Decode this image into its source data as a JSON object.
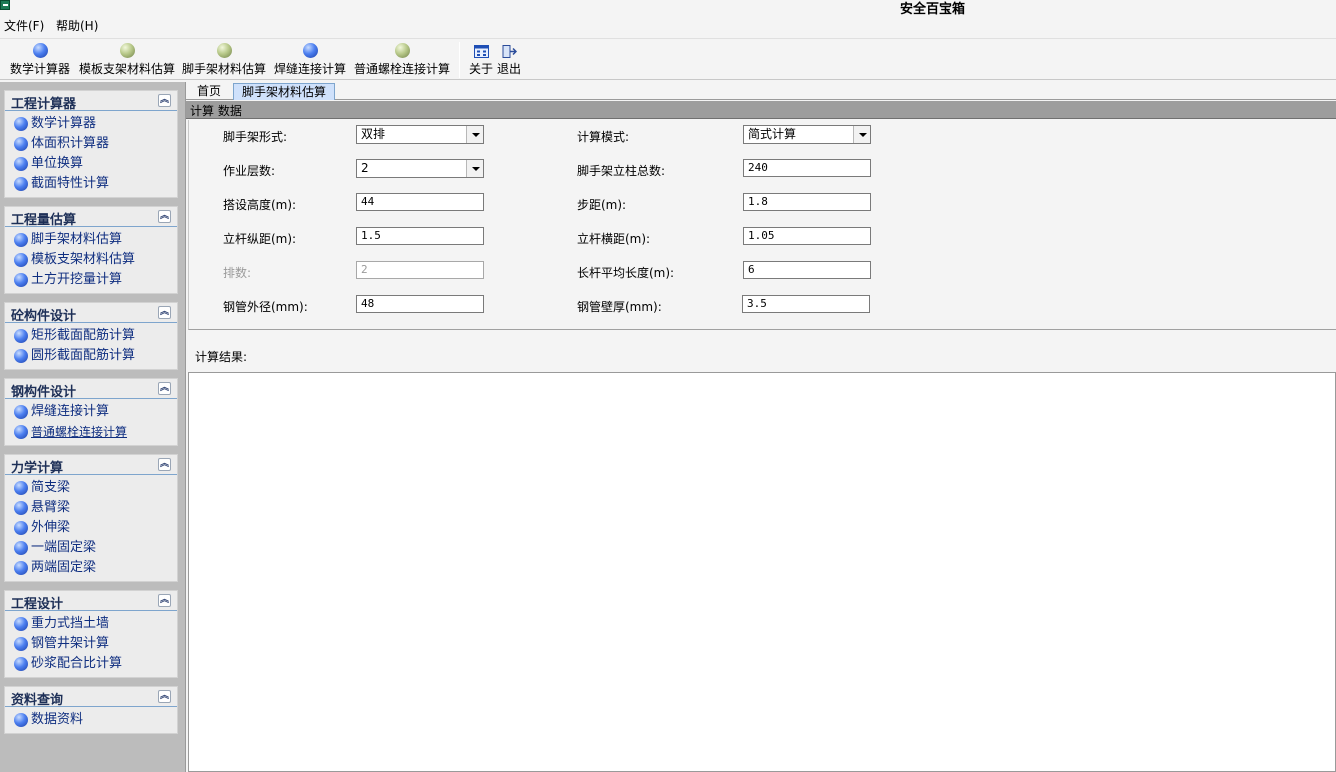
{
  "app": {
    "title": "安全百宝箱"
  },
  "menu": {
    "file": "文件(F)",
    "help": "帮助(H)"
  },
  "toolbar": {
    "buttons": [
      {
        "label": "数学计算器",
        "icon": "blue-ball-icon"
      },
      {
        "label": "模板支架材料估算",
        "icon": "green-ball-icon"
      },
      {
        "label": "脚手架材料估算",
        "icon": "green-ball-icon"
      },
      {
        "label": "焊缝连接计算",
        "icon": "blue-ball-icon"
      },
      {
        "label": "普通螺栓连接计算",
        "icon": "green-ball-icon"
      }
    ],
    "about": "关于",
    "exit": "退出"
  },
  "sidebar": {
    "panels": [
      {
        "title": "工程计算器",
        "items": [
          "数学计算器",
          "体面积计算器",
          "单位换算",
          "截面特性计算"
        ]
      },
      {
        "title": "工程量估算",
        "items": [
          "脚手架材料估算",
          "模板支架材料估算",
          "土方开挖量计算"
        ]
      },
      {
        "title": "砼构件设计",
        "items": [
          "矩形截面配筋计算",
          "圆形截面配筋计算"
        ]
      },
      {
        "title": "钢构件设计",
        "items": [
          "焊缝连接计算",
          "普通螺栓连接计算"
        ]
      },
      {
        "title": "力学计算",
        "items": [
          "简支梁",
          "悬臂梁",
          "外伸梁",
          "一端固定梁",
          "两端固定梁"
        ]
      },
      {
        "title": "工程设计",
        "items": [
          "重力式挡土墙",
          "钢管井架计算",
          "砂浆配合比计算"
        ]
      },
      {
        "title": "资料查询",
        "items": [
          "数据资料"
        ]
      }
    ]
  },
  "tabs": {
    "home": "首页",
    "active": "脚手架材料估算"
  },
  "section": {
    "title": "计算 数据"
  },
  "form": {
    "scaffold_type": {
      "label": "脚手架形式:",
      "value": "双排"
    },
    "calc_mode": {
      "label": "计算模式:",
      "value": "简式计算"
    },
    "work_layers": {
      "label": "作业层数:",
      "value": "2"
    },
    "total_posts": {
      "label": "脚手架立柱总数:",
      "value": "240"
    },
    "height": {
      "label": "搭设高度(m):",
      "value": "44"
    },
    "step": {
      "label": "步距(m):",
      "value": "1.8"
    },
    "long_spacing": {
      "label": "立杆纵距(m):",
      "value": "1.5"
    },
    "trans_spacing": {
      "label": "立杆横距(m):",
      "value": "1.05"
    },
    "rows": {
      "label": "排数:",
      "value": "2"
    },
    "avg_pole_length": {
      "label": "长杆平均长度(m):",
      "value": "6"
    },
    "tube_diameter": {
      "label": "钢管外径(mm):",
      "value": "48"
    },
    "tube_thickness": {
      "label": "钢管壁厚(mm):",
      "value": "3.5"
    }
  },
  "result": {
    "label": "计算结果:"
  }
}
